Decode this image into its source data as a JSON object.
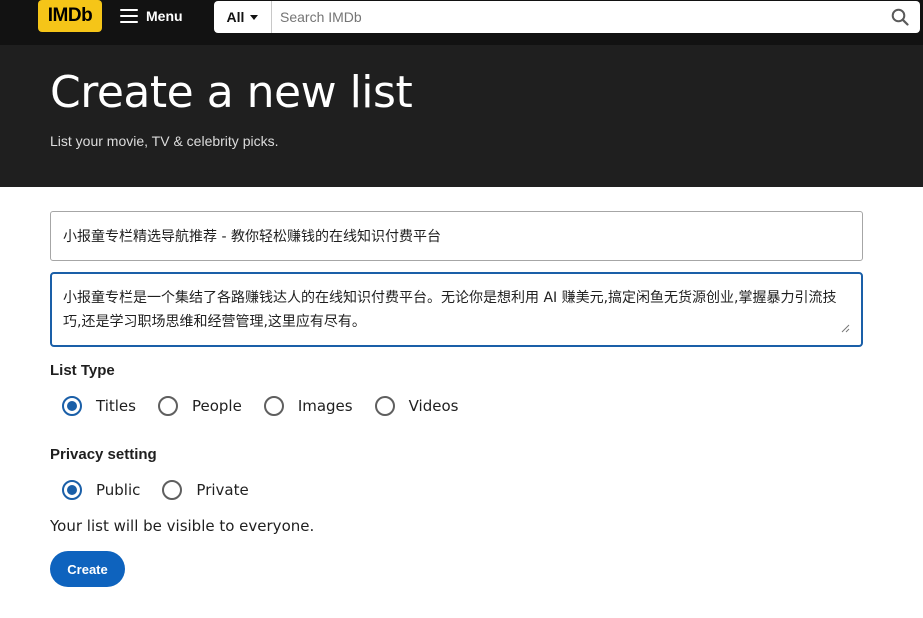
{
  "header": {
    "logo_text": "IMDb",
    "menu_label": "Menu",
    "search": {
      "category": "All",
      "placeholder": "Search IMDb"
    }
  },
  "hero": {
    "title": "Create a new list",
    "subtitle": "List your movie, TV & celebrity picks."
  },
  "form": {
    "title_value": "小报童专栏精选导航推荐 - 教你轻松赚钱的在线知识付费平台",
    "description_value": "小报童专栏是一个集结了各路赚钱达人的在线知识付费平台。无论你是想利用 AI 赚美元,搞定闲鱼无货源创业,掌握暴力引流技巧,还是学习职场思维和经营管理,这里应有尽有。",
    "list_type": {
      "label": "List Type",
      "options": [
        "Titles",
        "People",
        "Images",
        "Videos"
      ],
      "selected": "Titles"
    },
    "privacy": {
      "label": "Privacy setting",
      "options": [
        "Public",
        "Private"
      ],
      "selected": "Public"
    },
    "visibility_hint": "Your list will be visible to everyone.",
    "create_label": "Create"
  },
  "colors": {
    "brand_yellow": "#f5c518",
    "accent_blue": "#0e63be",
    "nav_bg": "#121212",
    "hero_bg": "#1f1f1f"
  }
}
